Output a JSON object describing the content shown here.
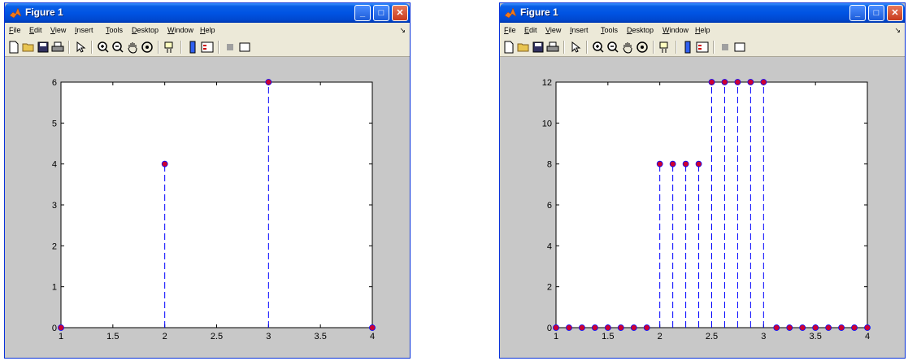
{
  "windows": [
    {
      "title": "Figure 1",
      "menus": [
        "File",
        "Edit",
        "View",
        "Insert",
        "Tools",
        "Desktop",
        "Window",
        "Help"
      ],
      "chart": {
        "type": "scatter",
        "style": "stem",
        "xlim": [
          1,
          4
        ],
        "ylim": [
          0,
          6
        ],
        "xticks": [
          "1",
          "1.5",
          "2",
          "2.5",
          "3",
          "3.5",
          "4"
        ],
        "yticks": [
          "0",
          "1",
          "2",
          "3",
          "4",
          "5",
          "6"
        ],
        "x": [
          1,
          2,
          3,
          4
        ],
        "y": [
          0,
          4,
          6,
          0
        ]
      }
    },
    {
      "title": "Figure 1",
      "menus": [
        "File",
        "Edit",
        "View",
        "Insert",
        "Tools",
        "Desktop",
        "Window",
        "Help"
      ],
      "chart": {
        "type": "scatter",
        "style": "stem",
        "xlim": [
          1,
          4
        ],
        "ylim": [
          0,
          12
        ],
        "xticks": [
          "1",
          "1.5",
          "2",
          "2.5",
          "3",
          "3.5",
          "4"
        ],
        "yticks": [
          "0",
          "2",
          "4",
          "6",
          "8",
          "10",
          "12"
        ],
        "x": [
          1,
          1.125,
          1.25,
          1.375,
          1.5,
          1.625,
          1.75,
          1.875,
          2,
          2.125,
          2.25,
          2.375,
          2.5,
          2.625,
          2.75,
          2.875,
          3,
          3.125,
          3.25,
          3.375,
          3.5,
          3.625,
          3.75,
          3.875,
          4
        ],
        "y": [
          0,
          0,
          0,
          0,
          0,
          0,
          0,
          0,
          8,
          8,
          8,
          8,
          12,
          12,
          12,
          12,
          12,
          0,
          0,
          0,
          0,
          0,
          0,
          0,
          0
        ]
      }
    }
  ],
  "colors": {
    "stem_line": "#0000ff",
    "marker_fill": "#cc0033",
    "marker_edge": "#0000ff",
    "figure_bg": "#c8c8c8",
    "axes_bg": "#ffffff"
  },
  "icons": [
    "new-file-icon",
    "open-folder-icon",
    "save-icon",
    "print-icon",
    "pointer-icon",
    "zoom-in-icon",
    "zoom-out-icon",
    "pan-hand-icon",
    "rotate-3d-icon",
    "data-cursor-icon",
    "colorbar-icon",
    "legend-icon",
    "hide-plot-tools-icon",
    "show-plot-tools-icon"
  ],
  "chart_data": [
    {
      "type": "scatter",
      "xlim": [
        1,
        4
      ],
      "ylim": [
        0,
        6
      ],
      "x": [
        1,
        2,
        3,
        4
      ],
      "y": [
        0,
        4,
        6,
        0
      ],
      "grid": false
    },
    {
      "type": "scatter",
      "xlim": [
        1,
        4
      ],
      "ylim": [
        0,
        12
      ],
      "x": [
        1,
        1.125,
        1.25,
        1.375,
        1.5,
        1.625,
        1.75,
        1.875,
        2,
        2.125,
        2.25,
        2.375,
        2.5,
        2.625,
        2.75,
        2.875,
        3,
        3.125,
        3.25,
        3.375,
        3.5,
        3.625,
        3.75,
        3.875,
        4
      ],
      "y": [
        0,
        0,
        0,
        0,
        0,
        0,
        0,
        0,
        8,
        8,
        8,
        8,
        12,
        12,
        12,
        12,
        12,
        0,
        0,
        0,
        0,
        0,
        0,
        0,
        0
      ],
      "grid": false
    }
  ]
}
